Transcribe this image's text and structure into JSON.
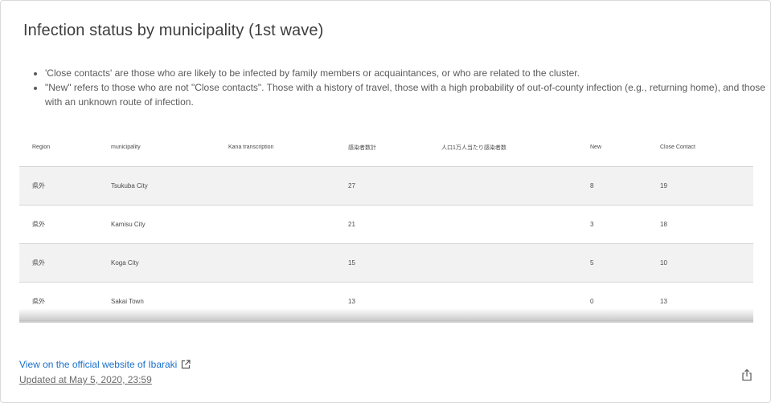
{
  "card": {
    "title": "Infection status by municipality (1st wave)",
    "notes": [
      "'Close contacts' are those who are likely to be infected by family members or acquaintances, or who are related to the cluster.",
      "\"New\" refers to those who are not \"Close contacts\". Those with a history of travel, those with a high probability of out-of-county infection (e.g., returning home), and those with an unknown route of infection."
    ]
  },
  "table": {
    "headers": {
      "region": "Region",
      "municipality": "municipality",
      "kana": "Kana transcription",
      "infected": "感染者数計",
      "per10k": "人口1万人当たり感染者数",
      "new": "New",
      "close": "Close Contact"
    },
    "rows": [
      {
        "region": "県外",
        "municipality": "Tsukuba City",
        "kana": "",
        "infected": "27",
        "per10k": "",
        "new": "8",
        "close": "19"
      },
      {
        "region": "県外",
        "municipality": "Kamisu City",
        "kana": "",
        "infected": "21",
        "per10k": "",
        "new": "3",
        "close": "18"
      },
      {
        "region": "県外",
        "municipality": "Koga City",
        "kana": "",
        "infected": "15",
        "per10k": "",
        "new": "5",
        "close": "10"
      },
      {
        "region": "県外",
        "municipality": "Sakai Town",
        "kana": "",
        "infected": "13",
        "per10k": "",
        "new": "0",
        "close": "13"
      }
    ]
  },
  "footer": {
    "link_text": "View on the official website of Ibaraki",
    "updated_text": "Updated at May 5, 2020, 23:59",
    "link_icon": "external-link-icon",
    "share_icon": "share-icon",
    "link_color": "#1a6fc9"
  }
}
